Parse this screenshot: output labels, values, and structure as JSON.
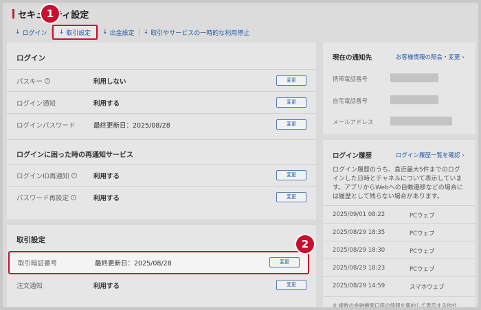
{
  "page_title": "セキュリティ設定",
  "nav": {
    "arrow": "↓",
    "items": [
      {
        "label": "ログイン"
      },
      {
        "label": "取引設定"
      },
      {
        "label": "出金設定"
      },
      {
        "label": "取引やサービスの一時的な利用停止"
      }
    ]
  },
  "login": {
    "title": "ログイン",
    "rows": [
      {
        "label": "パスキー",
        "value": "利用しない",
        "button": "変更"
      },
      {
        "label": "ログイン通知",
        "value": "利用する",
        "button": "変更"
      },
      {
        "label": "ログインパスワード",
        "value": "最終更新日：2025/08/28",
        "button": "変更"
      }
    ]
  },
  "recovery": {
    "title": "ログインに困った時の再通知サービス",
    "rows": [
      {
        "label": "ログインID再通知",
        "value": "利用する",
        "button": "変更"
      },
      {
        "label": "パスワード再設定",
        "value": "利用する",
        "button": "変更"
      }
    ]
  },
  "trade": {
    "title": "取引設定",
    "rows": [
      {
        "label": "取引暗証番号",
        "value": "最終更新日：2025/08/28",
        "button": "変更"
      },
      {
        "label": "注文通知",
        "value": "利用する",
        "button": "変更"
      }
    ]
  },
  "notify": {
    "title": "現在の通知先",
    "link": "お客様情報の照会・変更",
    "chevron": "›",
    "labels": [
      "携帯電話番号",
      "自宅電話番号",
      "メールアドレス"
    ]
  },
  "history": {
    "title": "ログイン履歴",
    "link": "ログイン履歴一覧を確認",
    "chevron": "›",
    "description": "ログイン履歴のうち、直近最大5件までのログインした日時とチャネルについて表示しています。アプリからWebへの自動遷移などの場合には履歴として残らない場合があります。",
    "entries": [
      {
        "date": "2025/09/01 08:22",
        "channel": "PCウェブ"
      },
      {
        "date": "2025/08/29 18:35",
        "channel": "PCウェブ"
      },
      {
        "date": "2025/08/29 18:30",
        "channel": "PCウェブ"
      },
      {
        "date": "2025/08/29 18:23",
        "channel": "PCウェブ"
      },
      {
        "date": "2025/08/29 14:59",
        "channel": "スマホウェブ"
      }
    ],
    "note": "※ 複数の金融機関口座の情報を集約して表示する他社"
  },
  "badges": [
    "1",
    "2"
  ],
  "icons": {
    "help": "?"
  },
  "colors": {
    "accent": "#c8102e",
    "link": "#2356a8",
    "title_bar": "#b8273a"
  }
}
